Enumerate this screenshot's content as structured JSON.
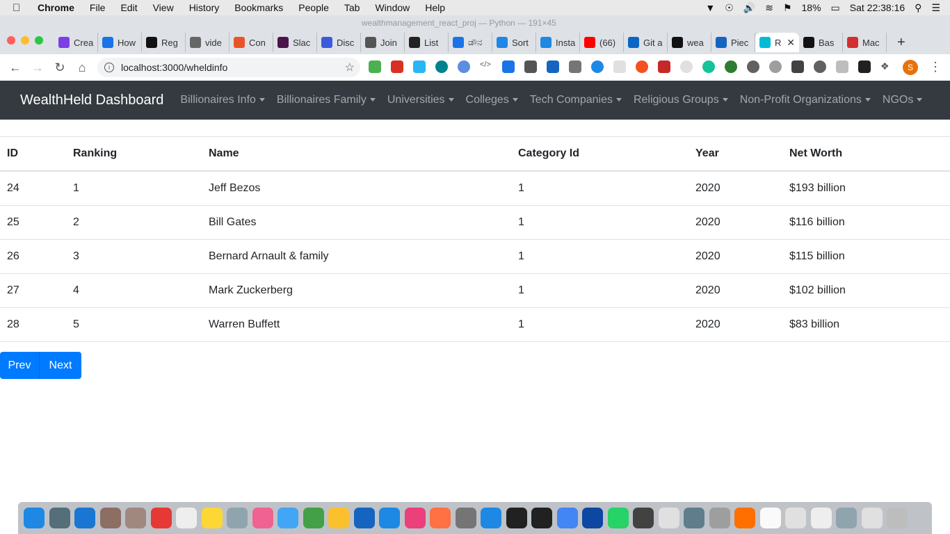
{
  "menubar": {
    "app_name": "Chrome",
    "items": [
      "File",
      "Edit",
      "View",
      "History",
      "Bookmarks",
      "People",
      "Tab",
      "Window",
      "Help"
    ],
    "battery": "18%",
    "clock": "Sat 22:38:16"
  },
  "window_title": "wealthmanagement_react_proj — Python — 191×45",
  "tabs": [
    {
      "label": "Crea",
      "color": "#7b3fe4"
    },
    {
      "label": "How",
      "color": "#1a73e8"
    },
    {
      "label": "Reg",
      "color": "#111111"
    },
    {
      "label": "vide",
      "color": "#666666"
    },
    {
      "label": "Con",
      "color": "#e8542a"
    },
    {
      "label": "Slac",
      "color": "#4a154b"
    },
    {
      "label": "Disc",
      "color": "#3b5bdb"
    },
    {
      "label": "Join",
      "color": "#555555"
    },
    {
      "label": "List",
      "color": "#222222"
    },
    {
      "label": "ಡೌನ",
      "color": "#1a73e8"
    },
    {
      "label": "Sort",
      "color": "#1e88e5"
    },
    {
      "label": "Insta",
      "color": "#1e88e5"
    },
    {
      "label": "(66)",
      "color": "#ff0000"
    },
    {
      "label": "Git a",
      "color": "#0a66c2"
    },
    {
      "label": "wea",
      "color": "#111111"
    },
    {
      "label": "Piec",
      "color": "#1565c0"
    },
    {
      "label": "R",
      "color": "#00bcd4",
      "active": true
    },
    {
      "label": "Bas",
      "color": "#111111"
    },
    {
      "label": "Mac",
      "color": "#d32f2f"
    }
  ],
  "address_bar": {
    "url": "localhost:3000/wheldinfo"
  },
  "navbar": {
    "brand": "WealthHeld Dashboard",
    "links": [
      "Billionaires Info",
      "Billionaires Family",
      "Universities",
      "Colleges",
      "Tech Companies",
      "Religious Groups",
      "Non-Profit Organizations",
      "NGOs"
    ]
  },
  "table": {
    "headers": [
      "ID",
      "Ranking",
      "Name",
      "Category Id",
      "Year",
      "Net Worth"
    ],
    "rows": [
      [
        "24",
        "1",
        "Jeff Bezos",
        "1",
        "2020",
        "$193 billion"
      ],
      [
        "25",
        "2",
        "Bill Gates",
        "1",
        "2020",
        "$116 billion"
      ],
      [
        "26",
        "3",
        "Bernard Arnault & family",
        "1",
        "2020",
        "$115 billion"
      ],
      [
        "27",
        "4",
        "Mark Zuckerberg",
        "1",
        "2020",
        "$102 billion"
      ],
      [
        "28",
        "5",
        "Warren Buffett",
        "1",
        "2020",
        "$83 billion"
      ]
    ]
  },
  "pagination": {
    "prev_label": "Prev",
    "next_label": "Next"
  },
  "colors": {
    "navbar_bg": "#343a40",
    "primary_button": "#007bff"
  }
}
